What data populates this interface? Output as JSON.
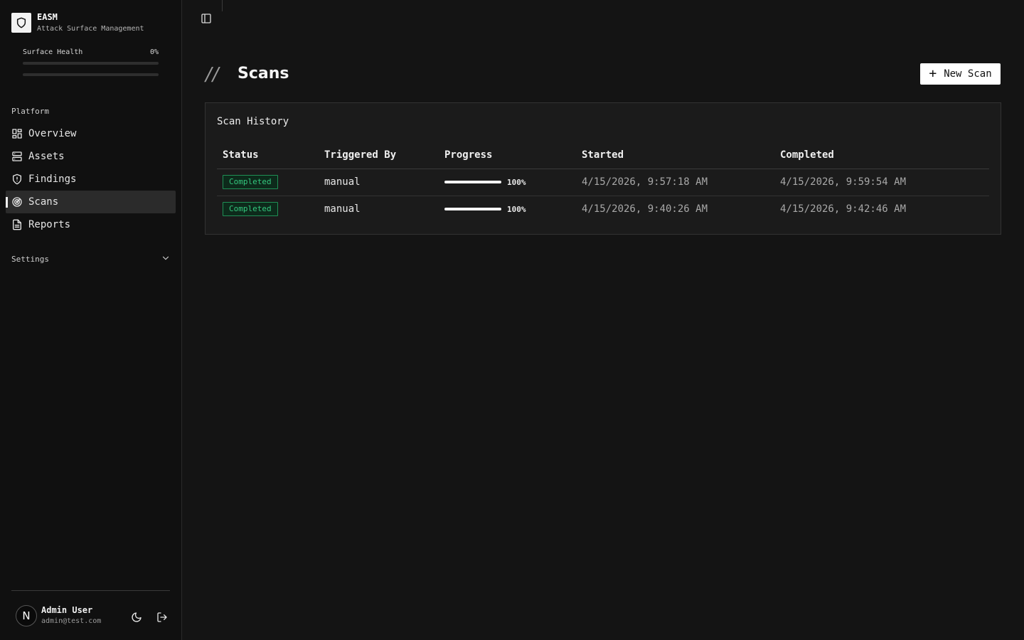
{
  "brand": {
    "name": "EASM",
    "subtitle": "Attack Surface Management"
  },
  "health": {
    "label": "Surface Health",
    "value": "0%",
    "fraction": 0
  },
  "sidebar": {
    "section_label": "Platform",
    "items": [
      {
        "label": "Overview",
        "icon": "grid-icon"
      },
      {
        "label": "Assets",
        "icon": "server-icon"
      },
      {
        "label": "Findings",
        "icon": "shield-icon"
      },
      {
        "label": "Scans",
        "icon": "radar-icon",
        "active": true
      },
      {
        "label": "Reports",
        "icon": "file-text-icon"
      }
    ],
    "settings_label": "Settings"
  },
  "user": {
    "avatar_letter": "N",
    "name": "Admin User",
    "email": "admin@test.com"
  },
  "page": {
    "title": "Scans",
    "new_scan_label": "New Scan"
  },
  "card": {
    "title": "Scan History"
  },
  "table": {
    "columns": [
      "Status",
      "Triggered By",
      "Progress",
      "Started",
      "Completed"
    ],
    "rows": [
      {
        "status": "Completed",
        "triggered_by": "manual",
        "progress": 1.0,
        "progress_label": "100%",
        "started": "4/15/2026, 9:57:18 AM",
        "completed": "4/15/2026, 9:59:54 AM"
      },
      {
        "status": "Completed",
        "triggered_by": "manual",
        "progress": 1.0,
        "progress_label": "100%",
        "started": "4/15/2026, 9:40:26 AM",
        "completed": "4/15/2026, 9:42:46 AM"
      }
    ]
  },
  "colors": {
    "accent": "#ffffff",
    "status_completed": "#34c77e",
    "background": "#141414",
    "sidebar": "#101010"
  }
}
